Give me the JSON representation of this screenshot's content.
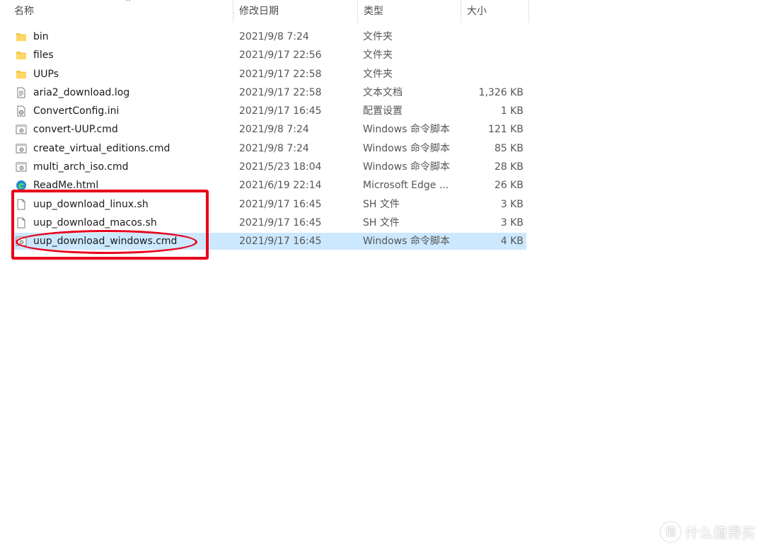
{
  "header": {
    "col_name": "名称",
    "col_date": "修改日期",
    "col_type": "类型",
    "col_size": "大小",
    "sort_indicator": "^"
  },
  "files": [
    {
      "name": "bin",
      "date": "2021/9/8 7:24",
      "type": "文件夹",
      "size": "",
      "icon": "folder-icon"
    },
    {
      "name": "files",
      "date": "2021/9/17 22:56",
      "type": "文件夹",
      "size": "",
      "icon": "folder-icon"
    },
    {
      "name": "UUPs",
      "date": "2021/9/17 22:58",
      "type": "文件夹",
      "size": "",
      "icon": "folder-icon"
    },
    {
      "name": "aria2_download.log",
      "date": "2021/9/17 22:58",
      "type": "文本文档",
      "size": "1,326 KB",
      "icon": "text-file-icon"
    },
    {
      "name": "ConvertConfig.ini",
      "date": "2021/9/17 16:45",
      "type": "配置设置",
      "size": "1 KB",
      "icon": "config-file-icon"
    },
    {
      "name": "convert-UUP.cmd",
      "date": "2021/9/8 7:24",
      "type": "Windows 命令脚本",
      "size": "121 KB",
      "icon": "cmd-script-icon"
    },
    {
      "name": "create_virtual_editions.cmd",
      "date": "2021/9/8 7:24",
      "type": "Windows 命令脚本",
      "size": "85 KB",
      "icon": "cmd-script-icon"
    },
    {
      "name": "multi_arch_iso.cmd",
      "date": "2021/5/23 18:04",
      "type": "Windows 命令脚本",
      "size": "28 KB",
      "icon": "cmd-script-icon"
    },
    {
      "name": "ReadMe.html",
      "date": "2021/6/19 22:14",
      "type": "Microsoft Edge ...",
      "size": "26 KB",
      "icon": "edge-icon"
    },
    {
      "name": "uup_download_linux.sh",
      "date": "2021/9/17 16:45",
      "type": "SH 文件",
      "size": "3 KB",
      "icon": "blank-file-icon"
    },
    {
      "name": "uup_download_macos.sh",
      "date": "2021/9/17 16:45",
      "type": "SH 文件",
      "size": "3 KB",
      "icon": "blank-file-icon"
    },
    {
      "name": "uup_download_windows.cmd",
      "date": "2021/9/17 16:45",
      "type": "Windows 命令脚本",
      "size": "4 KB",
      "icon": "cmd-script-icon",
      "selected": true
    }
  ],
  "colors": {
    "selection": "#cce8ff",
    "annotation": "#e8001c",
    "folder": "#f5c244",
    "edge": "#1f8ad6"
  },
  "watermark": {
    "logo_char": "值",
    "text": "什么值得买"
  }
}
